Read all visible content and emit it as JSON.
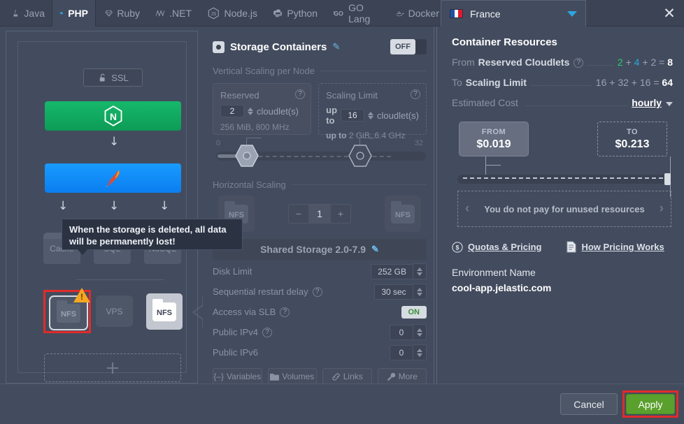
{
  "tabs": [
    {
      "label": "Java",
      "icon": "java-icon",
      "active": false
    },
    {
      "label": "PHP",
      "icon": "php-elephant-icon",
      "active": true
    },
    {
      "label": "Ruby",
      "icon": "ruby-gem-icon",
      "active": false
    },
    {
      "label": ".NET",
      "icon": "dotnet-icon",
      "active": false
    },
    {
      "label": "Node.js",
      "icon": "nodejs-icon",
      "active": false
    },
    {
      "label": "Python",
      "icon": "python-icon",
      "active": false
    },
    {
      "label": "GO Lang",
      "icon": "golang-icon",
      "active": false
    },
    {
      "label": "Docker",
      "icon": "docker-whale-icon",
      "active": false
    }
  ],
  "region": {
    "label": "France",
    "flag": "fr-flag-icon"
  },
  "close_label": "✕",
  "topology": {
    "ssl_label": "SSL",
    "nodes": {
      "nginx": "nginx-logo",
      "apache": "apache-feather-logo",
      "cache": "Cache",
      "sql": "SQL",
      "nosql": "NoSQL",
      "nfs_selected": "NFS",
      "vps": "VPS",
      "nfs_light": "NFS"
    },
    "add_label": "+"
  },
  "tooltip": {
    "text": "When the storage is deleted, all data will be permanently lost!"
  },
  "middle": {
    "title": "Storage Containers",
    "toggle": "OFF",
    "vertical_section": "Vertical Scaling per Node",
    "reserved": {
      "label": "Reserved",
      "value": "2",
      "unit": "cloudlet(s)",
      "note": "256 MiB, 800 MHz"
    },
    "scaling_limit": {
      "label": "Scaling Limit",
      "prefix": "up to",
      "value": "16",
      "unit": "cloudlet(s)",
      "note_prefix": "up to",
      "note": "2 GiB, 6.4 GHz"
    },
    "slider": {
      "min": "0",
      "max": "32"
    },
    "horizontal_section": "Horizontal Scaling",
    "node_count": "1",
    "minus": "−",
    "plus": "+",
    "node_badge": "NFS",
    "shared_storage": "Shared Storage 2.0-7.9",
    "options": [
      {
        "label": "Disk Limit",
        "value": "252 GB",
        "type": "spinner",
        "help": false
      },
      {
        "label": "Sequential restart delay",
        "value": "30  sec",
        "type": "spinner",
        "help": true
      },
      {
        "label": "Access via SLB",
        "value": "ON",
        "type": "toggle",
        "help": true
      },
      {
        "label": "Public IPv4",
        "value": "0",
        "type": "spinner",
        "help": true
      },
      {
        "label": "Public IPv6",
        "value": "0",
        "type": "spinner",
        "help": false
      }
    ],
    "chips": [
      {
        "label": "Variables",
        "icon": "braces-icon"
      },
      {
        "label": "Volumes",
        "icon": "folder-icon"
      },
      {
        "label": "Links",
        "icon": "link-icon"
      },
      {
        "label": "More",
        "icon": "wrench-icon"
      }
    ]
  },
  "right": {
    "title": "Container Resources",
    "from_row": {
      "prefix": "From",
      "key": "Reserved Cloudlets",
      "a": "2",
      "b": "4",
      "c": "2",
      "total": "8"
    },
    "to_row": {
      "prefix": "To",
      "key": "Scaling Limit",
      "a": "16",
      "b": "32",
      "c": "16",
      "total": "64"
    },
    "cost_row": {
      "label": "Estimated Cost",
      "period": "hourly"
    },
    "from_box": {
      "caption": "FROM",
      "amount": "$0.019"
    },
    "to_box": {
      "caption": "TO",
      "amount": "$0.213"
    },
    "unused": "You do not pay for unused resources",
    "links": [
      {
        "label": "Quotas & Pricing",
        "icon": "dollar-circle-icon"
      },
      {
        "label": "How Pricing Works",
        "icon": "document-icon"
      }
    ],
    "env_label": "Environment Name",
    "env_value": "cool-app.jelastic.com"
  },
  "footer": {
    "cancel": "Cancel",
    "apply": "Apply"
  },
  "colors": {
    "bg": "#434c5e",
    "tabbar": "#3b4354",
    "accent_blue": "#2ba6e0",
    "green": "#2ecc71",
    "apply_green": "#5aa02c",
    "alert_red": "#e12b2b",
    "warn_orange": "#f5a623",
    "nginx_green": "#16b86c",
    "apache_blue": "#189bff"
  }
}
